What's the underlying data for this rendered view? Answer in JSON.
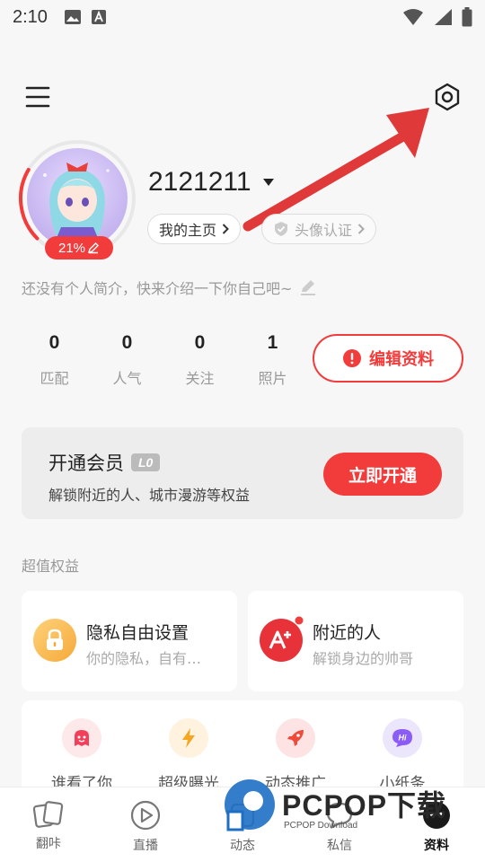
{
  "status_bar": {
    "time": "2:10"
  },
  "profile": {
    "username": "2121211",
    "progress_pct": 21,
    "progress_label": "21%",
    "home_label": "我的主页",
    "cert_label": "头像认证",
    "bio_placeholder": "还没有个人简介，快来介绍一下你自己吧~"
  },
  "stats": [
    {
      "value": "0",
      "label": "匹配"
    },
    {
      "value": "0",
      "label": "人气"
    },
    {
      "value": "0",
      "label": "关注"
    },
    {
      "value": "1",
      "label": "照片"
    }
  ],
  "edit_label": "编辑资料",
  "vip": {
    "title": "开通会员",
    "level": "L0",
    "subtitle": "解锁附近的人、城市漫游等权益",
    "button": "立即开通"
  },
  "benefits_section_title": "超值权益",
  "benefits": [
    {
      "title": "隐私自由设置",
      "subtitle": "你的隐私，自有…",
      "icon": "lock-icon"
    },
    {
      "title": "附近的人",
      "subtitle": "解锁身边的帅哥",
      "icon": "nearby-plus-icon"
    }
  ],
  "features": [
    {
      "label": "谁看了你",
      "icon": "ghost-icon"
    },
    {
      "label": "超级曝光",
      "icon": "lightning-icon"
    },
    {
      "label": "动态推广",
      "icon": "rocket-icon"
    },
    {
      "label": "小纸条",
      "icon": "hi-chat-icon"
    }
  ],
  "tabs": [
    {
      "label": "翻咔",
      "icon": "cards-icon"
    },
    {
      "label": "直播",
      "icon": "play-icon"
    },
    {
      "label": "动态",
      "icon": "feed-icon"
    },
    {
      "label": "私信",
      "icon": "message-icon"
    },
    {
      "label": "资料",
      "icon": "profile-icon",
      "active": true
    }
  ],
  "watermark": {
    "brand": "PCPOP下载",
    "sub": "PCPOP Download"
  },
  "colors": {
    "accent": "#f23c3c",
    "background": "#f7f7f7"
  }
}
